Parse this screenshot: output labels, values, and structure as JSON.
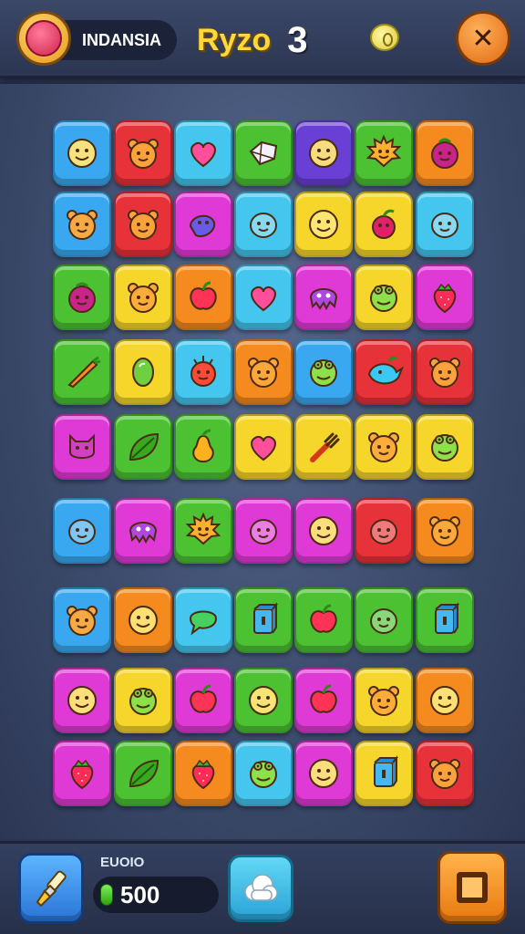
{
  "header": {
    "player_name": "INDANSIA",
    "level_name": "Ryzo",
    "level_number": "3",
    "avatar_icon": "candy-avatar-icon",
    "coin_icon": "coin-icon",
    "close_icon": "close-icon"
  },
  "board": {
    "columns": 7,
    "rows": [
      [
        "blue:face",
        "red:bear",
        "cyan:heart",
        "green:gem",
        "purple:face",
        "green:sun",
        "orange:berry"
      ],
      [
        "blue:bear",
        "red:bear",
        "magenta:fish",
        "cyan:blob",
        "yellow:face",
        "yellow:cherry",
        "cyan:blob"
      ],
      [
        "green:berry",
        "yellow:bear",
        "orange:apple",
        "cyan:heart",
        "magenta:octopus",
        "yellow:frog",
        "magenta:strawberry"
      ],
      [
        "green:carrot",
        "yellow:egg",
        "cyan:spiky",
        "orange:bear",
        "blue:frog",
        "red:bird",
        "red:bear"
      ],
      [
        "magenta:cat",
        "green:leaf",
        "green:pear",
        "yellow:heart",
        "yellow:fork",
        "yellow:bear",
        "yellow:frog"
      ],
      [
        "blue:blob",
        "magenta:octopus",
        "green:sun",
        "magenta:blob",
        "magenta:face",
        "red:blob",
        "orange:bear"
      ],
      [
        "blue:bear",
        "orange:face",
        "cyan:bubble",
        "green:box",
        "green:apple",
        "green:blob",
        "green:box"
      ],
      [
        "magenta:face",
        "yellow:frog",
        "magenta:apple",
        "green:face",
        "magenta:apple",
        "yellow:bear",
        "orange:face"
      ],
      [
        "magenta:strawberry",
        "green:leaf",
        "orange:strawberry",
        "cyan:frog",
        "magenta:face",
        "yellow:box",
        "red:bear"
      ]
    ],
    "tile_colors": {
      "blue": "#3aa8f0",
      "red": "#e8323a",
      "cyan": "#45c6ee",
      "green": "#4cc232",
      "purple": "#6a3fd6",
      "orange": "#f58a1f",
      "yellow": "#f6d62a",
      "magenta": "#e03ad6"
    }
  },
  "footer": {
    "brush_icon": "paintbrush-icon",
    "score_label": "EUOIO",
    "score_icon": "green-gem-icon",
    "score_value": "500",
    "cloud_icon": "cloud-icon",
    "menu_icon": "square-icon"
  }
}
